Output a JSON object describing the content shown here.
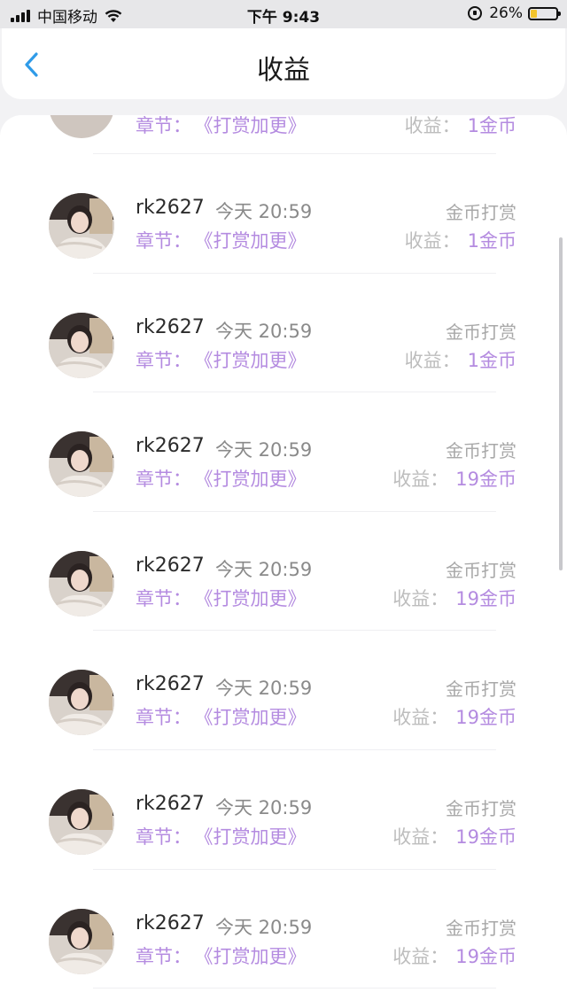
{
  "status_bar": {
    "carrier": "中国移动",
    "time": "下午 9:43",
    "battery": "26%",
    "battery_level": 0.26
  },
  "nav": {
    "title": "收益",
    "back_icon": "chevron-left-icon"
  },
  "colors": {
    "accent_purple": "#b48be0",
    "back_blue": "#2f9be8"
  },
  "top_partial_row": {
    "chapter_label": "章节：",
    "chapter_name": "《打赏加更》",
    "income_label": "收益：",
    "income_amount": "1金币"
  },
  "records": [
    {
      "user": "rk2627",
      "time": "今天 20:59",
      "type": "金币打赏",
      "chapter_label": "章节：",
      "chapter_name": "《打赏加更》",
      "income_label": "收益：",
      "income_amount": "1金币"
    },
    {
      "user": "rk2627",
      "time": "今天 20:59",
      "type": "金币打赏",
      "chapter_label": "章节：",
      "chapter_name": "《打赏加更》",
      "income_label": "收益：",
      "income_amount": "1金币"
    },
    {
      "user": "rk2627",
      "time": "今天 20:59",
      "type": "金币打赏",
      "chapter_label": "章节：",
      "chapter_name": "《打赏加更》",
      "income_label": "收益：",
      "income_amount": "19金币"
    },
    {
      "user": "rk2627",
      "time": "今天 20:59",
      "type": "金币打赏",
      "chapter_label": "章节：",
      "chapter_name": "《打赏加更》",
      "income_label": "收益：",
      "income_amount": "19金币"
    },
    {
      "user": "rk2627",
      "time": "今天 20:59",
      "type": "金币打赏",
      "chapter_label": "章节：",
      "chapter_name": "《打赏加更》",
      "income_label": "收益：",
      "income_amount": "19金币"
    },
    {
      "user": "rk2627",
      "time": "今天 20:59",
      "type": "金币打赏",
      "chapter_label": "章节：",
      "chapter_name": "《打赏加更》",
      "income_label": "收益：",
      "income_amount": "19金币"
    },
    {
      "user": "rk2627",
      "time": "今天 20:59",
      "type": "金币打赏",
      "chapter_label": "章节：",
      "chapter_name": "《打赏加更》",
      "income_label": "收益：",
      "income_amount": "19金币"
    }
  ]
}
